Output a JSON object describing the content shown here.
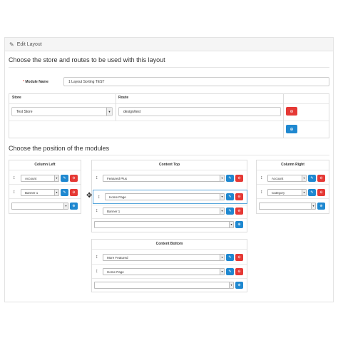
{
  "panel": {
    "title": "Edit Layout",
    "icon": "pencil-icon"
  },
  "section1": {
    "title": "Choose the store and routes to be used with this layout"
  },
  "module_name": {
    "required_mark": "*",
    "label": "Module Name",
    "value": "1 Layout Sorting TEST"
  },
  "route_table": {
    "headers": [
      "Store",
      "Route"
    ],
    "rows": [
      {
        "store": "Test Store",
        "route": "design/test"
      }
    ]
  },
  "section2": {
    "title": "Choose the position of the modules"
  },
  "column_left": {
    "title": "Column Left",
    "modules": [
      "Account",
      "Banner 1"
    ],
    "add_value": ""
  },
  "content_top": {
    "title": "Content Top",
    "modules": [
      "Featured Plus",
      "Home Page",
      "Banner 1"
    ],
    "add_value": ""
  },
  "column_right": {
    "title": "Column Right",
    "modules": [
      "Account",
      "Category"
    ],
    "add_value": ""
  },
  "content_bottom": {
    "title": "Content Bottom",
    "modules": [
      "More Featured",
      "Home Page"
    ],
    "add_value": ""
  },
  "colors": {
    "red": "#e53935",
    "blue": "#1f88d0",
    "highlight": "#5aa7dc"
  },
  "icons": {
    "edit": "pencil-icon",
    "remove": "minus-circle-icon",
    "add": "plus-circle-icon",
    "drag": "drag-handle-icon",
    "dropdown": "caret-down-icon",
    "cursor": "move-cursor-icon"
  }
}
